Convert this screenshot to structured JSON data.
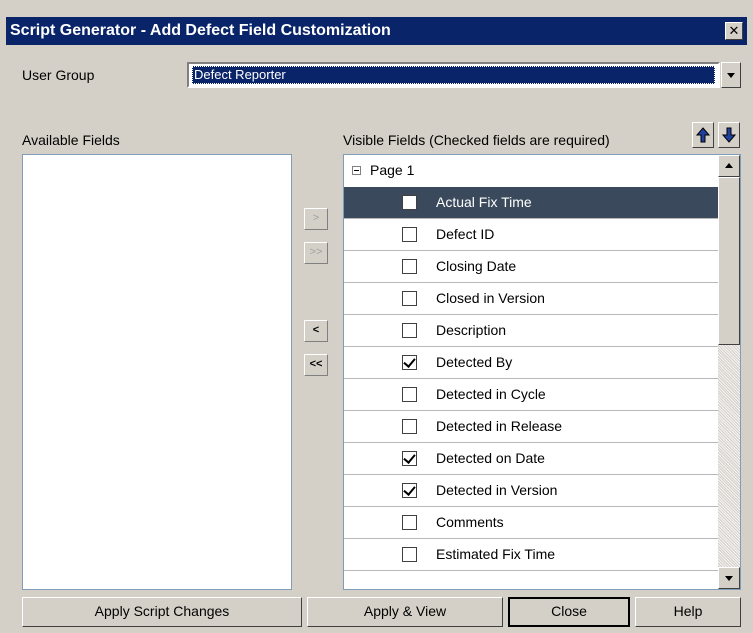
{
  "window": {
    "title": "Script Generator - Add Defect Field Customization",
    "close_glyph": "✕"
  },
  "user_group": {
    "label": "User Group",
    "selected": "Defect Reporter"
  },
  "available_fields": {
    "label": "Available Fields",
    "items": []
  },
  "move_buttons": {
    "add": ">",
    "add_all": ">>",
    "remove": "<",
    "remove_all": "<<"
  },
  "visible_fields": {
    "label": "Visible Fields (Checked fields are required)",
    "group": "Page 1",
    "rows": [
      {
        "label": "Actual Fix Time",
        "checked": false,
        "selected": true
      },
      {
        "label": "Defect ID",
        "checked": false,
        "selected": false
      },
      {
        "label": "Closing Date",
        "checked": false,
        "selected": false
      },
      {
        "label": "Closed in Version",
        "checked": false,
        "selected": false
      },
      {
        "label": "Description",
        "checked": false,
        "selected": false
      },
      {
        "label": "Detected By",
        "checked": true,
        "selected": false
      },
      {
        "label": "Detected in Cycle",
        "checked": false,
        "selected": false
      },
      {
        "label": "Detected in Release",
        "checked": false,
        "selected": false
      },
      {
        "label": "Detected on Date",
        "checked": true,
        "selected": false
      },
      {
        "label": "Detected in Version",
        "checked": true,
        "selected": false
      },
      {
        "label": "Comments",
        "checked": false,
        "selected": false
      },
      {
        "label": "Estimated Fix Time",
        "checked": false,
        "selected": false
      }
    ]
  },
  "buttons": {
    "apply_script_changes": "Apply Script Changes",
    "apply_view": "Apply & View",
    "close": "Close",
    "help": "Help"
  },
  "colors": {
    "title_bar": "#0a246a",
    "selected_row": "#3a4a5c",
    "window_bg": "#d4d0c8"
  }
}
